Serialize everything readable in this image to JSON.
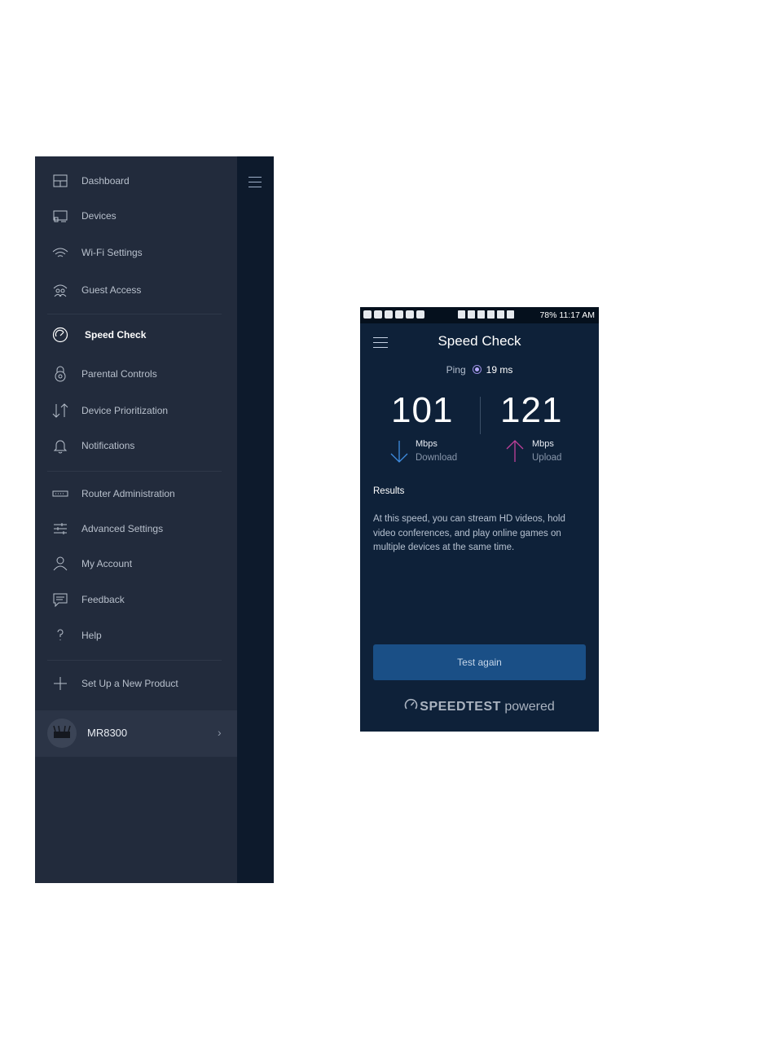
{
  "drawer": {
    "items_group1": [
      {
        "label": "Dashboard",
        "icon": "dashboard-icon"
      },
      {
        "label": "Devices",
        "icon": "devices-icon"
      },
      {
        "label": "Wi-Fi Settings",
        "icon": "wifi-icon"
      },
      {
        "label": "Guest Access",
        "icon": "guest-access-icon"
      }
    ],
    "items_group2": [
      {
        "label": "Speed Check",
        "icon": "speedometer-icon",
        "active": true
      },
      {
        "label": "Parental Controls",
        "icon": "lock-icon"
      },
      {
        "label": "Device Prioritization",
        "icon": "priority-arrows-icon"
      },
      {
        "label": "Notifications",
        "icon": "bell-icon"
      }
    ],
    "items_group3": [
      {
        "label": "Router Administration",
        "icon": "router-icon"
      },
      {
        "label": "Advanced Settings",
        "icon": "sliders-icon"
      },
      {
        "label": "My Account",
        "icon": "user-icon"
      },
      {
        "label": "Feedback",
        "icon": "chat-icon"
      },
      {
        "label": "Help",
        "icon": "question-icon"
      }
    ],
    "setup_label": "Set Up a New Product",
    "product": {
      "name": "MR8300"
    }
  },
  "phone": {
    "status_bar": {
      "text": "78% 11:17 AM"
    },
    "title": "Speed Check",
    "ping": {
      "label": "Ping",
      "value": "19 ms"
    },
    "download": {
      "value": "101",
      "unit": "Mbps",
      "label": "Download"
    },
    "upload": {
      "value": "121",
      "unit": "Mbps",
      "label": "Upload"
    },
    "results_title": "Results",
    "results_text": "At this speed, you can stream HD videos, hold video conferences, and play online games on multiple devices at the same time.",
    "button_label": "Test again",
    "brand": {
      "bold": "SPEEDTEST",
      "light": "powered"
    }
  },
  "colors": {
    "drawer_bg": "#222b3c",
    "phone_bg": "#0e2139",
    "download_arrow": "#3f8de0",
    "upload_arrow": "#c0409a",
    "button_bg": "#1a4f86"
  }
}
